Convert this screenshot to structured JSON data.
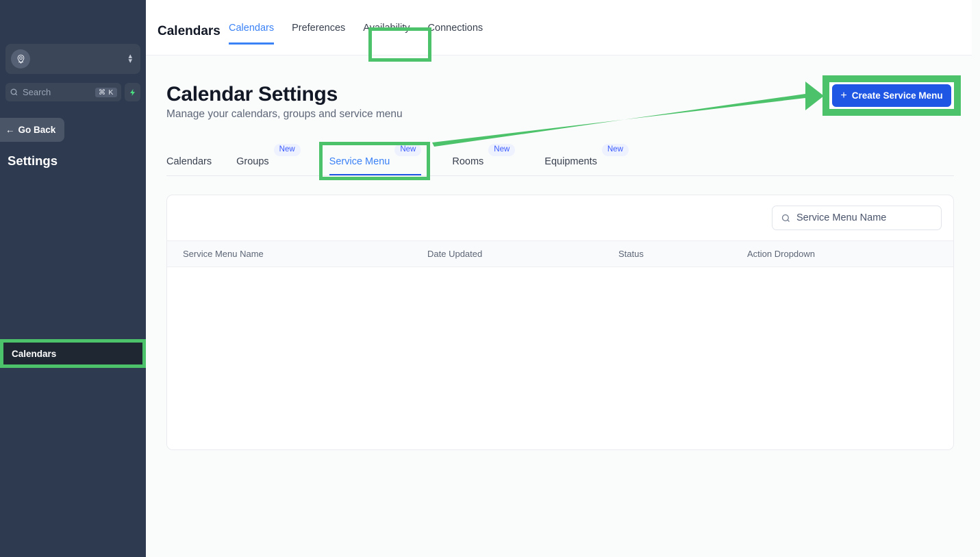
{
  "sidebar": {
    "org_switcher": {
      "name": "org-switcher",
      "icon": "location-pin-avatar-icon",
      "chevron_up": "▴",
      "chevron_down": "▾"
    },
    "search": {
      "placeholder": "Search",
      "shortcut": "⌘ K",
      "icon": "search-icon"
    },
    "spark_button": {
      "icon": "⚡",
      "label": ""
    },
    "go_back": {
      "label": "Go Back",
      "arrow": "←"
    },
    "heading": "Settings",
    "nav_items": [
      {
        "label": "Calendars",
        "active": true,
        "highlighted": true
      }
    ]
  },
  "topbar": {
    "title": "Calendars",
    "tabs": [
      {
        "label": "Calendars",
        "active": true,
        "highlighted": true
      },
      {
        "label": "Preferences",
        "active": false,
        "highlighted": false
      },
      {
        "label": "Availability",
        "active": false,
        "highlighted": false
      },
      {
        "label": "Connections",
        "active": false,
        "highlighted": false
      }
    ]
  },
  "page": {
    "title": "Calendar Settings",
    "subtitle": "Manage your calendars, groups and service menu",
    "create_button": {
      "label": "Create Service Menu",
      "icon": "plus-icon",
      "highlighted": true
    }
  },
  "subtabs": [
    {
      "label": "Calendars",
      "badge": "",
      "active": false
    },
    {
      "label": "Groups",
      "badge": "New",
      "active": false
    },
    {
      "label": "Service Menu",
      "badge": "New",
      "active": true,
      "highlighted": true
    },
    {
      "label": "Rooms",
      "badge": "New",
      "active": false
    },
    {
      "label": "Equipments",
      "badge": "New",
      "active": false
    }
  ],
  "table": {
    "search": {
      "placeholder": "Service Menu Name",
      "icon": "search-icon",
      "value": ""
    },
    "columns": [
      "Service Menu Name",
      "Date Updated",
      "Status",
      "Action Dropdown"
    ],
    "rows": []
  },
  "colors": {
    "highlight_green": "#4cc36a",
    "accent_blue": "#3b82f6",
    "button_blue": "#1f56e3",
    "sidebar_bg": "#2e3a4f",
    "badge_bg": "#eef2fe",
    "badge_text": "#3b5bfd"
  }
}
